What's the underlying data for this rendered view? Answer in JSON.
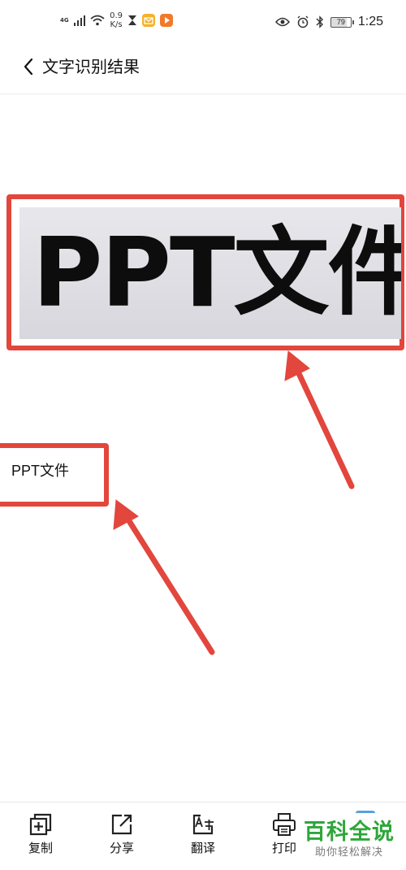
{
  "status_bar": {
    "network": "4G",
    "speed_value": "0.9",
    "speed_unit": "K/s",
    "battery": "79",
    "time": "1:25"
  },
  "header": {
    "title": "文字识别结果"
  },
  "source_image": {
    "text": "PPT文件"
  },
  "result": {
    "text": "PPT文件"
  },
  "toolbar": {
    "items": [
      {
        "label": "复制",
        "icon": "copy-icon"
      },
      {
        "label": "分享",
        "icon": "share-icon"
      },
      {
        "label": "翻译",
        "icon": "translate-icon"
      },
      {
        "label": "打印",
        "icon": "print-icon"
      }
    ]
  },
  "watermark": {
    "title": "百科全说",
    "subtitle": "助你轻松解决"
  },
  "colors": {
    "highlight": "#e2463c",
    "watermark_green": "#2ea63a"
  }
}
